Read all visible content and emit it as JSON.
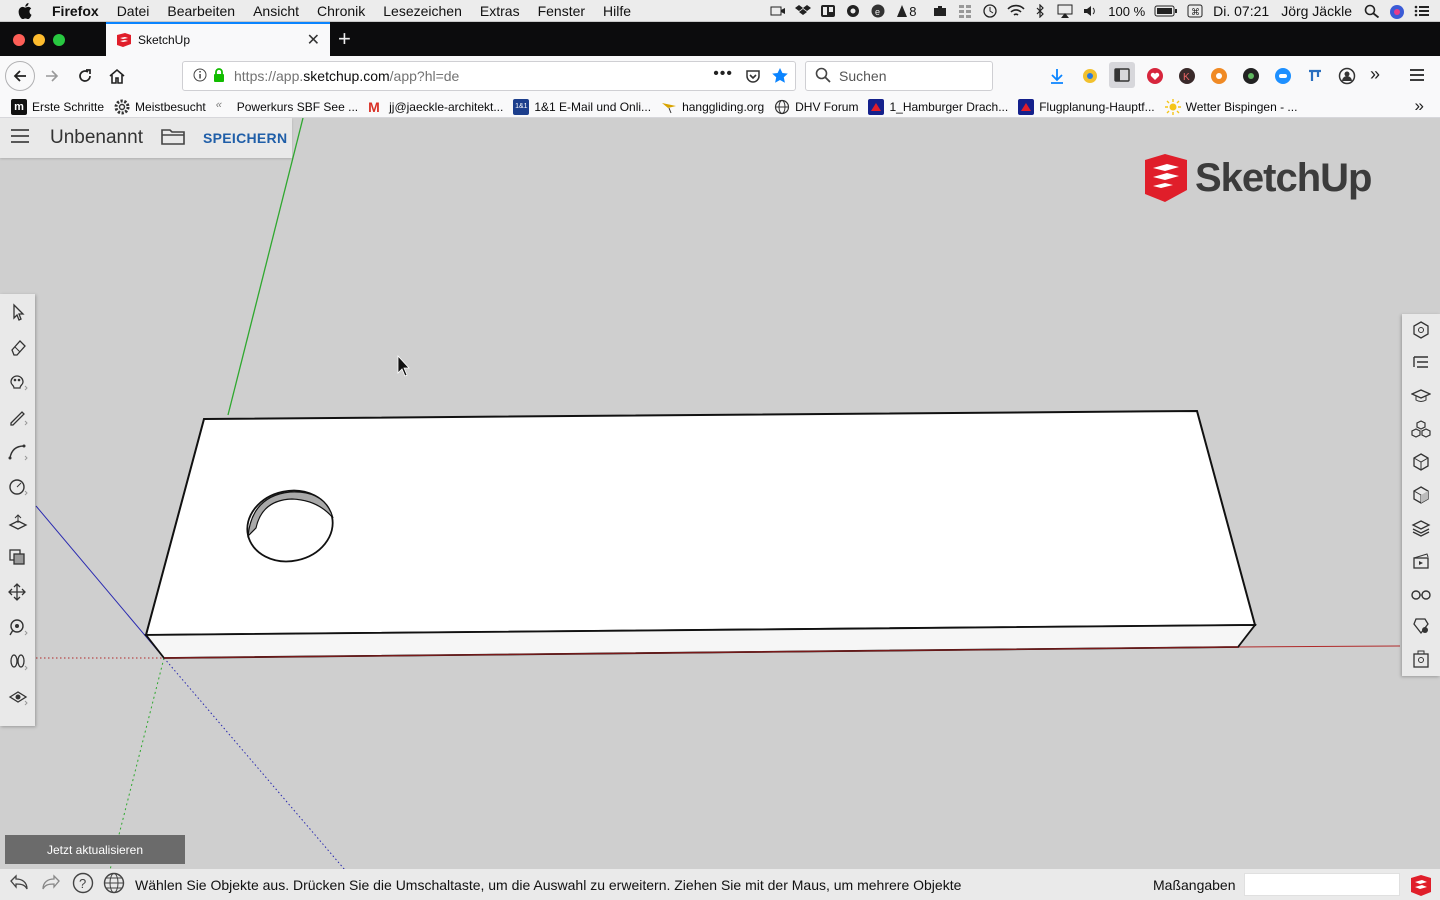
{
  "menubar": {
    "app_name": "Firefox",
    "items": [
      "Datei",
      "Bearbeiten",
      "Ansicht",
      "Chronik",
      "Lesezeichen",
      "Extras",
      "Fenster",
      "Hilfe"
    ],
    "notification_count": "8",
    "battery": "100 %",
    "clock": "Di. 07:21",
    "user": "Jörg Jäckle"
  },
  "browser": {
    "tab_title": "SketchUp",
    "url_base": "https://app.",
    "url_domain": "sketchup.com",
    "url_path": "/app?hl=de",
    "search_placeholder": "Suchen",
    "bookmarks": [
      "Erste Schritte",
      "Meistbesucht",
      "Powerkurs SBF See ...",
      "jj@jaeckle-architekt...",
      "1&1 E-Mail und Onli...",
      "hanggliding.org",
      "DHV Forum",
      "1_Hamburger Drach...",
      "Flugplanung-Hauptf...",
      "Wetter Bispingen - ..."
    ]
  },
  "app": {
    "doc_title": "Unbenannt",
    "save_label": "SPEICHERN",
    "brand": "SketchUp",
    "update_label": "Jetzt aktualisieren",
    "status_text": "Wählen Sie Objekte aus. Drücken Sie die Umschaltaste, um die Auswahl zu erweitern. Ziehen Sie mit der Maus, um mehrere Objekte",
    "measurements_label": "Maßangaben",
    "measurements_value": "",
    "left_tools": [
      "select-tool",
      "eraser-tool",
      "paint-bucket-tool",
      "line-tool",
      "arc-tool",
      "shape-tool",
      "push-pull-tool",
      "offset-tool",
      "move-tool",
      "tape-measure-tool",
      "orbit-tool",
      "section-tool"
    ],
    "right_panels": [
      "entity-info-panel",
      "outliner-panel",
      "instructor-panel",
      "components-panel",
      "materials-panel",
      "styles-panel",
      "layers-panel",
      "scenes-panel",
      "display-panel",
      "ruby-panel",
      "model-info-panel"
    ]
  },
  "colors": {
    "accent_blue": "#0a84ff",
    "save_blue": "#1f5ea8",
    "brand_red": "#e01e2a",
    "axis_green": "#2fa82f",
    "axis_red": "#b02a2a",
    "axis_blue": "#2a2ab0"
  }
}
